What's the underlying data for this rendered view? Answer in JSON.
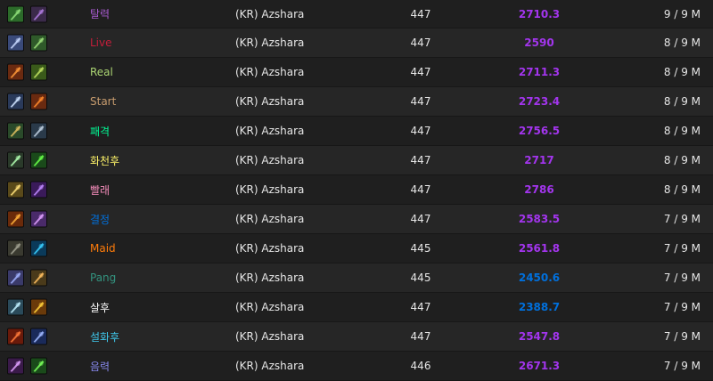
{
  "rows": [
    {
      "name": "탈력",
      "name_color": "#a95bd1",
      "realm": "(KR) Azshara",
      "ilvl": "447",
      "score": "2710.3",
      "score_color": "#a335ee",
      "progress": "9 / 9 M",
      "icon1": "fist-weapon-icon",
      "icon2": "demon-mask-icon",
      "i1": [
        "#2c6b2a",
        "#8fe07a"
      ],
      "i2": [
        "#3b2a4a",
        "#b07be0"
      ]
    },
    {
      "name": "Live",
      "name_color": "#c41e3a",
      "realm": "(KR) Azshara",
      "ilvl": "447",
      "score": "2590",
      "score_color": "#a335ee",
      "progress": "8 / 9 M",
      "icon1": "crossed-swords-icon",
      "icon2": "skull-icon",
      "i1": [
        "#3a4a7a",
        "#c8d8ff"
      ],
      "i2": [
        "#2f5a2a",
        "#9ee07a"
      ]
    },
    {
      "name": "Real",
      "name_color": "#abd473",
      "realm": "(KR) Azshara",
      "ilvl": "447",
      "score": "2711.3",
      "score_color": "#a335ee",
      "progress": "8 / 9 M",
      "icon1": "flame-blade-icon",
      "icon2": "claw-icon",
      "i1": [
        "#6a2a10",
        "#ff9a3a"
      ],
      "i2": [
        "#3a5a1a",
        "#c0e060"
      ]
    },
    {
      "name": "Start",
      "name_color": "#c79c6e",
      "realm": "(KR) Azshara",
      "ilvl": "447",
      "score": "2723.4",
      "score_color": "#a335ee",
      "progress": "8 / 9 M",
      "icon1": "sword-icon",
      "icon2": "fire-mask-icon",
      "i1": [
        "#2a3a5a",
        "#d0e4ff"
      ],
      "i2": [
        "#6a2a10",
        "#ff8a2a"
      ]
    },
    {
      "name": "패격",
      "name_color": "#00ff98",
      "realm": "(KR) Azshara",
      "ilvl": "447",
      "score": "2756.5",
      "score_color": "#a335ee",
      "progress": "8 / 9 M",
      "icon1": "monk-icon",
      "icon2": "wolf-icon",
      "i1": [
        "#2a4a2a",
        "#e0c060"
      ],
      "i2": [
        "#2a3a4a",
        "#c0d0e0"
      ]
    },
    {
      "name": "화천후",
      "name_color": "#fff468",
      "realm": "(KR) Azshara",
      "ilvl": "447",
      "score": "2717",
      "score_color": "#a335ee",
      "progress": "8 / 9 M",
      "icon1": "dagger-icon",
      "icon2": "poison-blade-icon",
      "i1": [
        "#2a3a2a",
        "#b0ffb0"
      ],
      "i2": [
        "#1a4a1a",
        "#6aff4a"
      ]
    },
    {
      "name": "빨래",
      "name_color": "#f48cba",
      "realm": "(KR) Azshara",
      "ilvl": "447",
      "score": "2786",
      "score_color": "#a335ee",
      "progress": "8 / 9 M",
      "icon1": "hammer-icon",
      "icon2": "shadow-orb-icon",
      "i1": [
        "#5a4a1a",
        "#ffe07a"
      ],
      "i2": [
        "#3a1a5a",
        "#c08aff"
      ]
    },
    {
      "name": "결정",
      "name_color": "#0070dd",
      "realm": "(KR) Azshara",
      "ilvl": "447",
      "score": "2583.5",
      "score_color": "#a335ee",
      "progress": "7 / 9 M",
      "icon1": "fire-burst-icon",
      "icon2": "demon-face-icon",
      "i1": [
        "#6a2a0a",
        "#ffb03a"
      ],
      "i2": [
        "#4a2a6a",
        "#e0a0ff"
      ]
    },
    {
      "name": "Maid",
      "name_color": "#ff7c0a",
      "realm": "(KR) Azshara",
      "ilvl": "445",
      "score": "2561.8",
      "score_color": "#a335ee",
      "progress": "7 / 9 M",
      "icon1": "cage-icon",
      "icon2": "eye-icon",
      "i1": [
        "#3a3a30",
        "#a0a090"
      ],
      "i2": [
        "#0a3a5a",
        "#3ad0ff"
      ]
    },
    {
      "name": "Pang",
      "name_color": "#33937f",
      "realm": "(KR) Azshara",
      "ilvl": "445",
      "score": "2450.6",
      "score_color": "#0070dd",
      "progress": "7 / 9 M",
      "icon1": "wing-icon",
      "icon2": "spiral-icon",
      "i1": [
        "#3a3a6a",
        "#a0b0ff"
      ],
      "i2": [
        "#4a3a1a",
        "#ffc060"
      ]
    },
    {
      "name": "살후",
      "name_color": "#ffffff",
      "realm": "(KR) Azshara",
      "ilvl": "447",
      "score": "2388.7",
      "score_color": "#0070dd",
      "progress": "7 / 9 M",
      "icon1": "cross-icon",
      "icon2": "sun-icon",
      "i1": [
        "#2a4a5a",
        "#c0f0ff"
      ],
      "i2": [
        "#6a3a0a",
        "#ffd03a"
      ]
    },
    {
      "name": "설화후",
      "name_color": "#3fc7eb",
      "realm": "(KR) Azshara",
      "ilvl": "447",
      "score": "2547.8",
      "score_color": "#a335ee",
      "progress": "7 / 9 M",
      "icon1": "fire-sword-icon",
      "icon2": "arcane-blade-icon",
      "i1": [
        "#6a1a0a",
        "#ff7a3a"
      ],
      "i2": [
        "#1a2a5a",
        "#a0b8ff"
      ]
    },
    {
      "name": "음력",
      "name_color": "#8788ee",
      "realm": "(KR) Azshara",
      "ilvl": "446",
      "score": "2671.3",
      "score_color": "#a335ee",
      "progress": "7 / 9 M",
      "icon1": "shadow-claw-icon",
      "icon2": "fel-skull-icon",
      "i1": [
        "#3a1a4a",
        "#e0a0ff"
      ],
      "i2": [
        "#1a4a1a",
        "#7aff5a"
      ]
    }
  ]
}
